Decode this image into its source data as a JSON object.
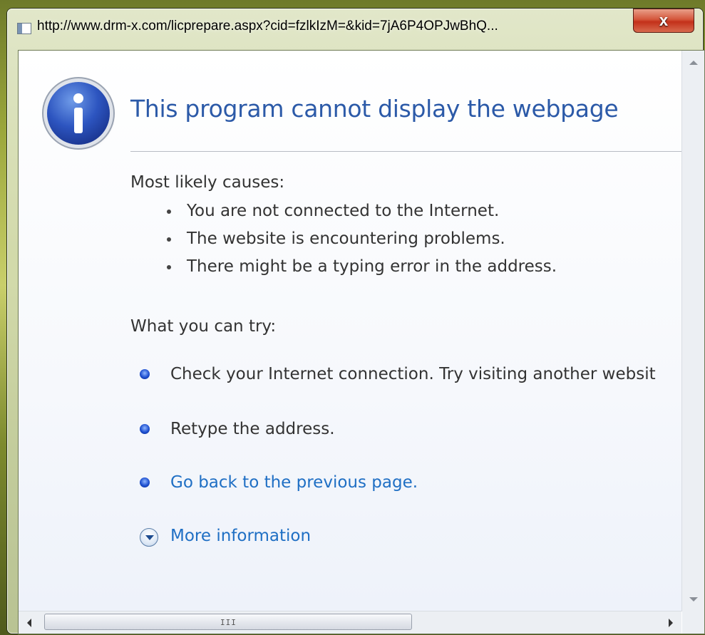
{
  "window": {
    "title": "http://www.drm-x.com/licprepare.aspx?cid=fzlkIzM=&kid=7jA6P4OPJwBhQ...",
    "close_label": "x"
  },
  "page": {
    "heading": "This program cannot display the webpage",
    "causes_label": "Most likely causes:",
    "causes": [
      "You are not connected to the Internet.",
      "The website is encountering problems.",
      "There might be a typing error in the address."
    ],
    "try_label": "What you can try:",
    "try_items": [
      "Check your Internet connection. Try visiting another websit",
      "Retype the address.",
      "Go back to the previous page."
    ],
    "more_info": "More information"
  },
  "scrollbar": {
    "grip": "III"
  },
  "colors": {
    "heading": "#2c5aa8",
    "link": "#1f6fc4",
    "body_text": "#333333",
    "close_button": "#c3301a"
  },
  "icons": {
    "title": "page-icon",
    "info": "info-icon",
    "bullet": "blue-bullet-icon",
    "more": "chevron-down-circle-icon"
  }
}
